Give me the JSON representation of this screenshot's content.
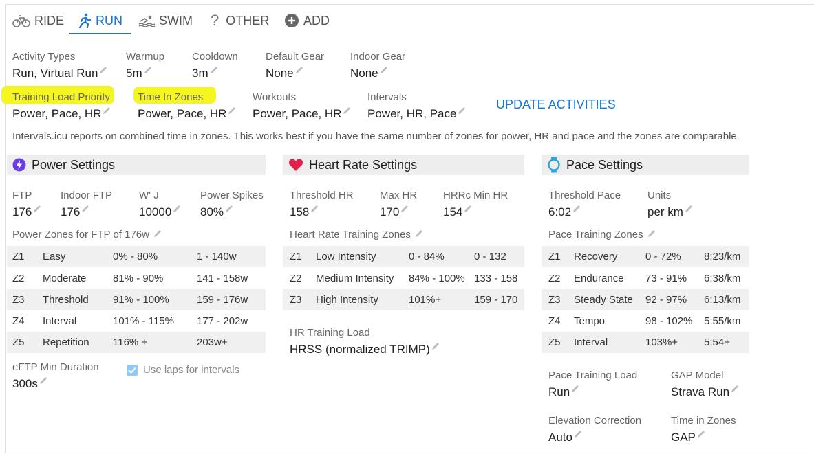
{
  "tabs": [
    {
      "label": "RIDE",
      "icon": "bike-icon"
    },
    {
      "label": "RUN",
      "icon": "runner-icon",
      "active": true
    },
    {
      "label": "SWIM",
      "icon": "swimmer-icon"
    },
    {
      "label": "OTHER",
      "icon": "question-icon"
    },
    {
      "label": "ADD",
      "icon": "plus-circle-icon"
    }
  ],
  "general": {
    "activity_types": {
      "label": "Activity Types",
      "value": "Run, Virtual Run"
    },
    "warmup": {
      "label": "Warmup",
      "value": "5m"
    },
    "cooldown": {
      "label": "Cooldown",
      "value": "3m"
    },
    "default_gear": {
      "label": "Default Gear",
      "value": "None"
    },
    "indoor_gear": {
      "label": "Indoor Gear",
      "value": "None"
    },
    "training_load_priority": {
      "label": "Training Load Priority",
      "value": "Power, Pace, HR"
    },
    "time_in_zones": {
      "label": "Time In Zones",
      "value": "Power, Pace, HR"
    },
    "workouts": {
      "label": "Workouts",
      "value": "Power, Pace, HR"
    },
    "intervals": {
      "label": "Intervals",
      "value": "Power, HR, Pace"
    },
    "update_button": "UPDATE ACTIVITIES",
    "info_text": "Intervals.icu reports on combined time in zones. This works best if you have the same number of zones for power, HR and pace and the zones are comparable."
  },
  "highlight_color": "#f5f520",
  "accent_color": "#1976d2",
  "power": {
    "title": "Power Settings",
    "icon": "bolt-icon",
    "icon_color": "#6a3de8",
    "ftp": {
      "label": "FTP",
      "value": "176"
    },
    "indoor_ftp": {
      "label": "Indoor FTP",
      "value": "176"
    },
    "wj": {
      "label": "W' J",
      "value": "10000"
    },
    "spikes": {
      "label": "Power Spikes",
      "value": "80%"
    },
    "zones_title": "Power Zones for FTP of 176w",
    "zones": [
      {
        "z": "Z1",
        "name": "Easy",
        "pct": "0% - 80%",
        "range": "1 - 140w"
      },
      {
        "z": "Z2",
        "name": "Moderate",
        "pct": "81% - 90%",
        "range": "141 - 158w"
      },
      {
        "z": "Z3",
        "name": "Threshold",
        "pct": "91% - 100%",
        "range": "159 - 176w"
      },
      {
        "z": "Z4",
        "name": "Interval",
        "pct": "101% - 115%",
        "range": "177 - 202w"
      },
      {
        "z": "Z5",
        "name": "Repetition",
        "pct": "116% +",
        "range": "203w+"
      }
    ],
    "eftp": {
      "label": "eFTP Min Duration",
      "value": "300s"
    },
    "use_laps": {
      "label": "Use laps for intervals",
      "checked": true
    }
  },
  "hr": {
    "title": "Heart Rate Settings",
    "icon": "heart-icon",
    "icon_color": "#e0204a",
    "threshold": {
      "label": "Threshold HR",
      "value": "158"
    },
    "max": {
      "label": "Max HR",
      "value": "170"
    },
    "hrrc": {
      "label": "HRRc Min HR",
      "value": "154"
    },
    "zones_title": "Heart Rate Training Zones",
    "zones": [
      {
        "z": "Z1",
        "name": "Low Intensity",
        "pct": "0 - 84%",
        "range": "0 - 132"
      },
      {
        "z": "Z2",
        "name": "Medium Intensity",
        "pct": "84% - 100%",
        "range": "133 - 158"
      },
      {
        "z": "Z3",
        "name": "High Intensity",
        "pct": "101%+",
        "range": "159 - 170"
      }
    ],
    "training_load": {
      "label": "HR Training Load",
      "value": "HRSS (normalized TRIMP)"
    }
  },
  "pace": {
    "title": "Pace Settings",
    "icon": "stopwatch-icon",
    "icon_color": "#29a3e0",
    "threshold": {
      "label": "Threshold Pace",
      "value": "6:02"
    },
    "units": {
      "label": "Units",
      "value": "per km"
    },
    "zones_title": "Pace Training Zones",
    "zones": [
      {
        "z": "Z1",
        "name": "Recovery",
        "pct": "0 - 72%",
        "range": "8:23/km"
      },
      {
        "z": "Z2",
        "name": "Endurance",
        "pct": "73 - 91%",
        "range": "6:38/km"
      },
      {
        "z": "Z3",
        "name": "Steady State",
        "pct": "92 - 97%",
        "range": "6:13/km"
      },
      {
        "z": "Z4",
        "name": "Tempo",
        "pct": "98 - 102%",
        "range": "5:55/km"
      },
      {
        "z": "Z5",
        "name": "Interval",
        "pct": "103%+",
        "range": "5:54+"
      }
    ],
    "training_load": {
      "label": "Pace Training Load",
      "value": "Run"
    },
    "gap_model": {
      "label": "GAP Model",
      "value": "Strava Run"
    },
    "elevation": {
      "label": "Elevation Correction",
      "value": "Auto"
    },
    "time_in_zones": {
      "label": "Time in Zones",
      "value": "GAP"
    }
  }
}
